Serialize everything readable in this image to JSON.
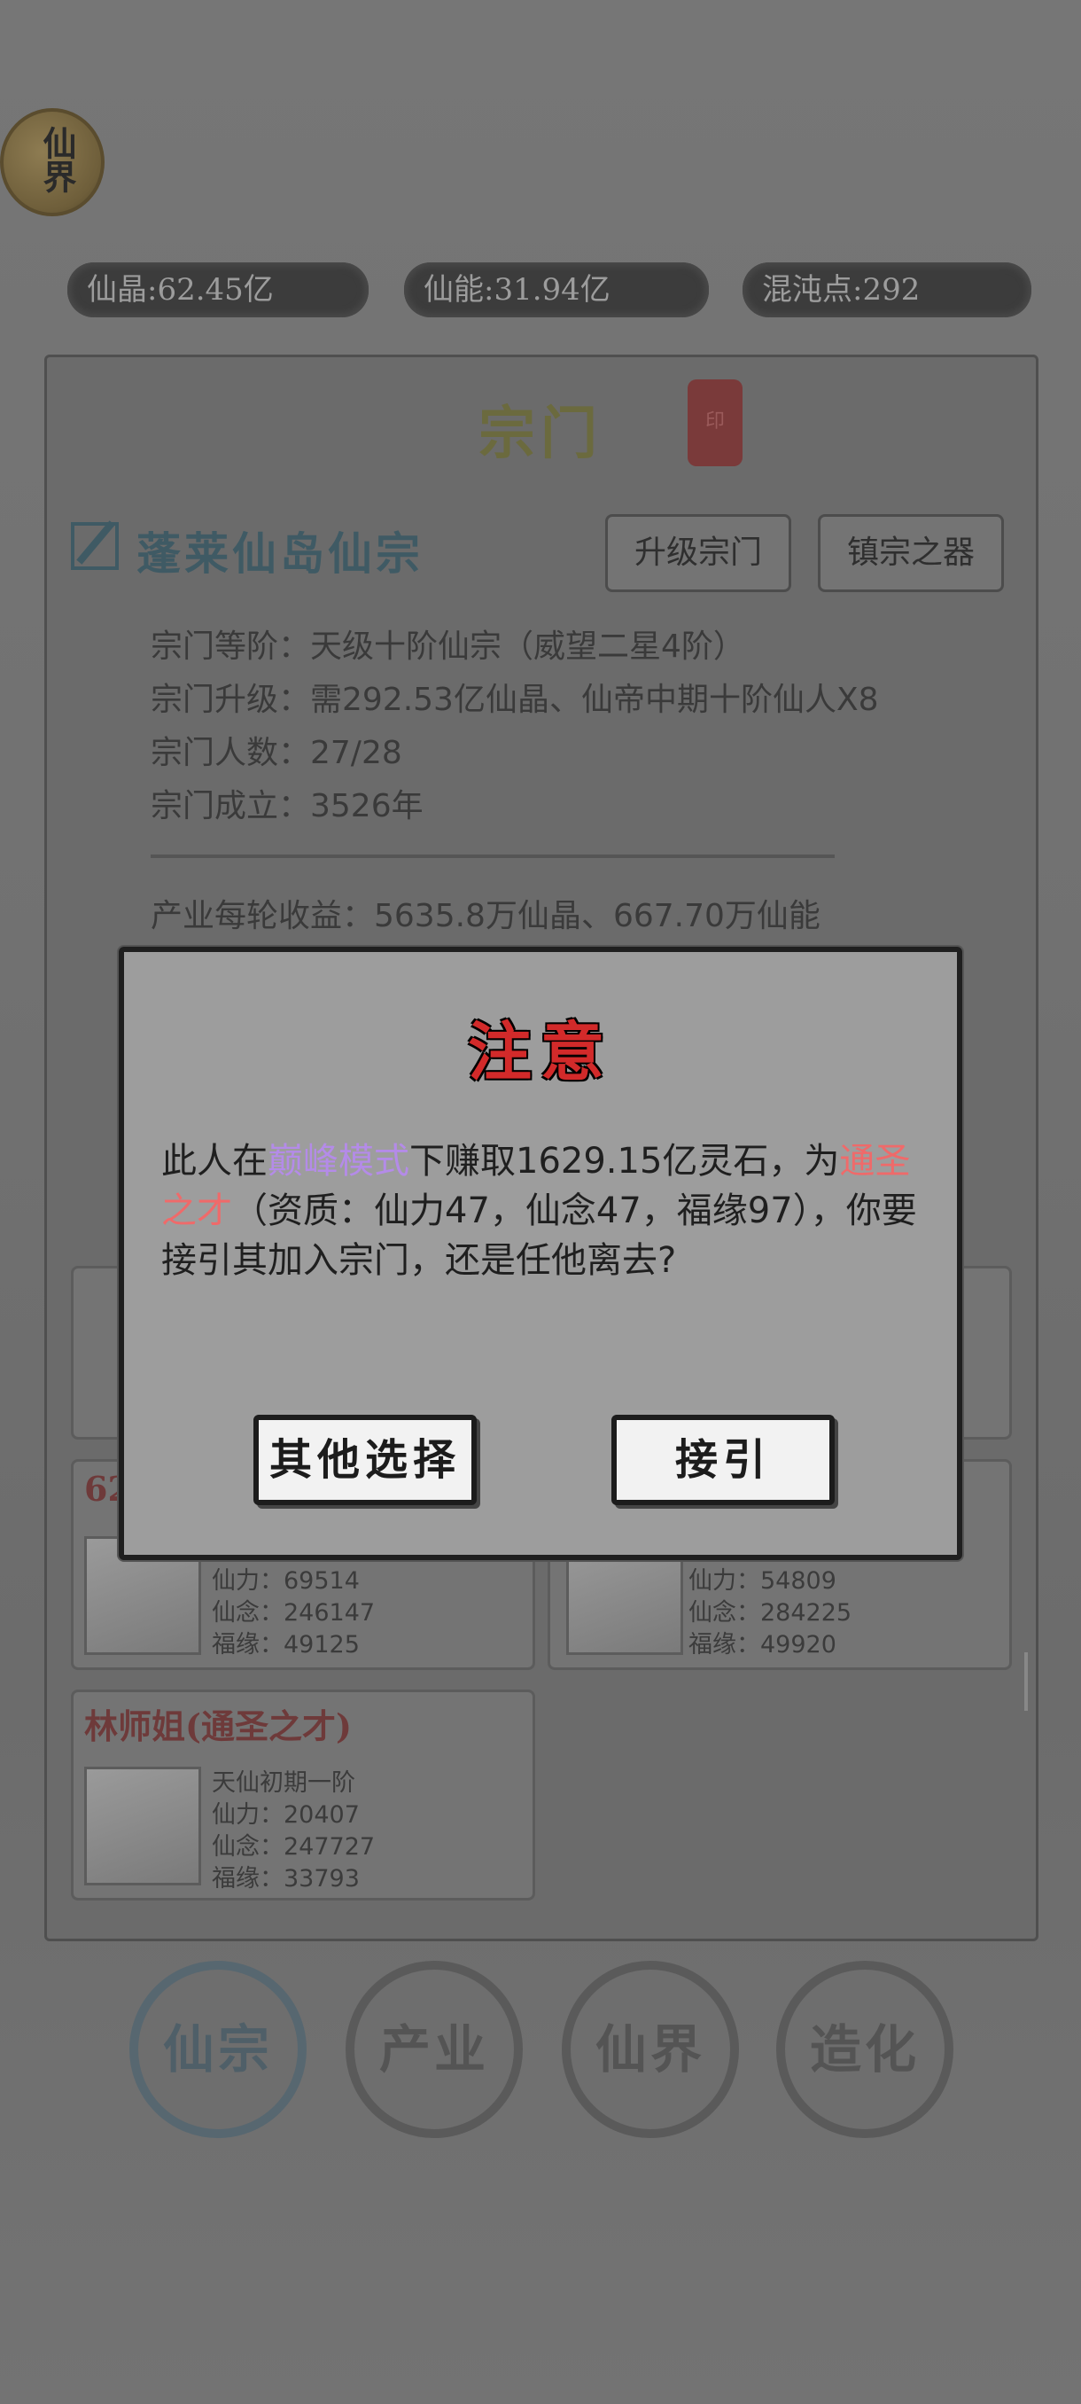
{
  "emblem": {
    "label": "仙界"
  },
  "resources": [
    {
      "label": "仙晶:62.45亿"
    },
    {
      "label": "仙能:31.94亿"
    },
    {
      "label": "混沌点:292"
    }
  ],
  "panel": {
    "title": "宗门",
    "seal_text": "印",
    "sect_name": "蓬莱仙岛仙宗",
    "upgrade_button": "升级宗门",
    "artifact_button": "镇宗之器",
    "info": [
      "宗门等阶：天级十阶仙宗（威望二星4阶）",
      "宗门升级：需292.53亿仙晶、仙帝中期十阶仙人X8",
      "宗门人数：27/28",
      "宗门成立：3526年"
    ],
    "income": "产业每轮收益：5635.8万仙晶、667.70万仙能"
  },
  "cards": [
    {
      "name": "",
      "stats": [
        "",
        "",
        "",
        ""
      ]
    },
    {
      "name": "",
      "stats": [
        "",
        "",
        "",
        ""
      ]
    },
    {
      "name": "62",
      "stats": [
        "",
        "仙力：69514",
        "仙念：246147",
        "福缘：49125"
      ]
    },
    {
      "name": "",
      "stats": [
        "",
        "仙力：54809",
        "仙念：284225",
        "福缘：49920"
      ]
    },
    {
      "name": "林师姐(通圣之才)",
      "stats": [
        "天仙初期一阶",
        "仙力：20407",
        "仙念：247727",
        "福缘：33793"
      ]
    }
  ],
  "nav": [
    {
      "label": "仙宗"
    },
    {
      "label": "产业"
    },
    {
      "label": "仙界"
    },
    {
      "label": "造化"
    }
  ],
  "dialog": {
    "title": "注意",
    "msg_pre": "此人在",
    "msg_mode": "巅峰模式",
    "msg_mid": "下赚取1629.15亿灵石，为",
    "msg_talent": "通圣之才",
    "msg_post": "（资质：仙力47，仙念47，福缘97），你要接引其加入宗门，还是任他离去?",
    "btn_other": "其他选择",
    "btn_accept": "接引"
  },
  "colors": {
    "accent_red": "#d22a2a",
    "purple": "#b48be8",
    "talent_red": "#ef6a6a"
  }
}
